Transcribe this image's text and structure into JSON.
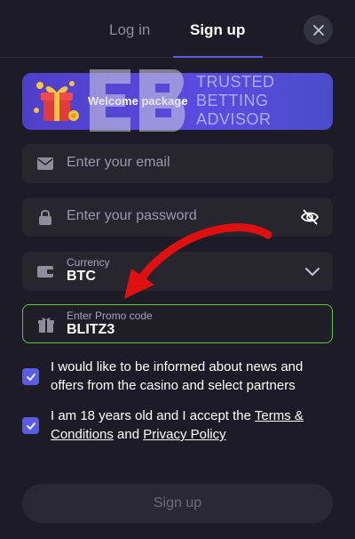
{
  "tabs": {
    "login": "Log in",
    "signup": "Sign up"
  },
  "banner": {
    "label": "Welcome package"
  },
  "watermark": {
    "line1": "TRUSTED",
    "line2": "BETTING",
    "line3": "ADVISOR"
  },
  "form": {
    "email_placeholder": "Enter your email",
    "password_placeholder": "Enter your password",
    "currency_label": "Currency",
    "currency_value": "BTC",
    "promo_label": "Enter Promo code",
    "promo_value": "BLITZ3"
  },
  "consents": {
    "news": {
      "checked": true,
      "text": "I would like to be informed about news and offers from the casino and select partners"
    },
    "age": {
      "checked": true,
      "text_prefix": "I am 18 years old and I accept the ",
      "terms_link": "Terms & Conditions",
      "text_middle": " and ",
      "privacy_link": "Privacy Policy"
    }
  },
  "submit_label": "Sign up",
  "colors": {
    "accent": "#5b5ce6",
    "promo_border": "#5ec43a",
    "arrow": "#e01010"
  },
  "icons": [
    "close-icon",
    "gift-icon",
    "mail-icon",
    "lock-icon",
    "eye-off-icon",
    "wallet-icon",
    "chevron-down-icon",
    "promo-gift-icon",
    "check-icon"
  ]
}
